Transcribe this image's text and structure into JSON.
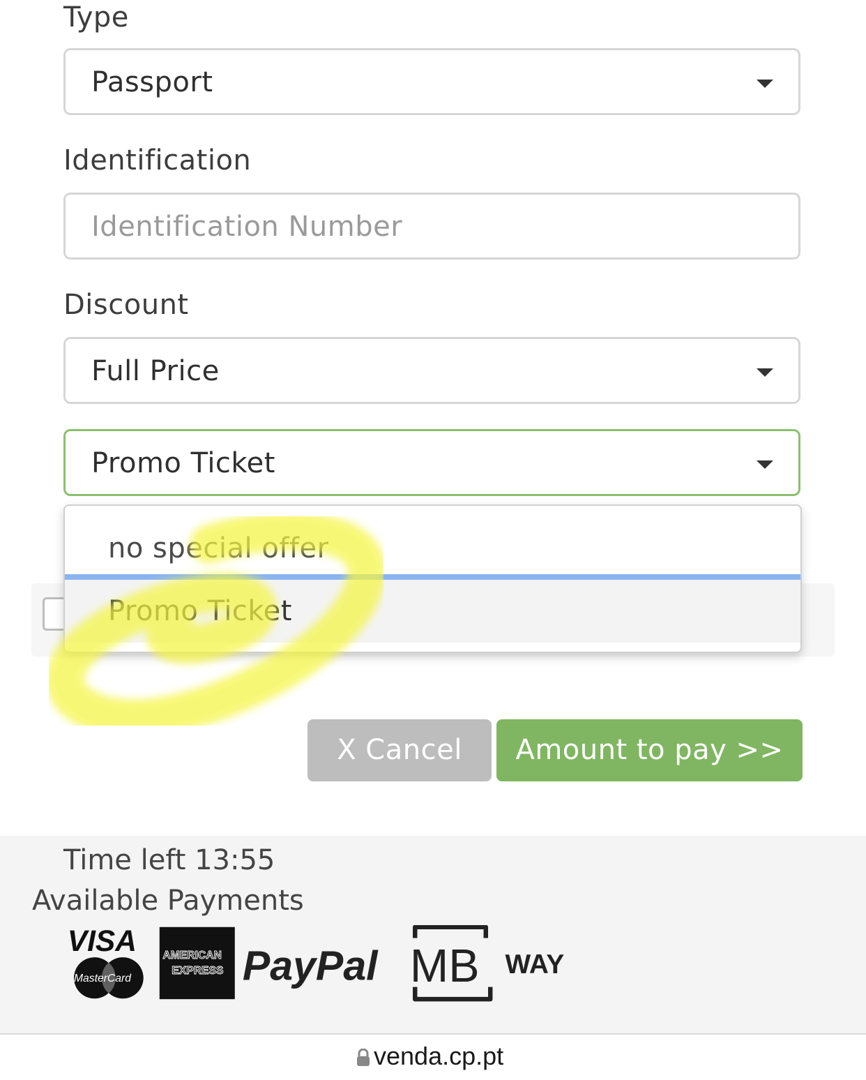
{
  "form": {
    "type_label": "Type",
    "type_value": "Passport",
    "identification_label": "Identification",
    "identification_placeholder": "Identification Number",
    "discount_label": "Discount",
    "discount_value": "Full Price",
    "promo_value": "Promo Ticket"
  },
  "dropdown": {
    "options": [
      {
        "label": "no special offer",
        "selected": false
      },
      {
        "label": "Promo Ticket",
        "selected": true
      }
    ]
  },
  "buttons": {
    "cancel_label": "X Cancel",
    "pay_label": "Amount to pay >>"
  },
  "footer": {
    "timer_text": "Time left 13:55",
    "payments_label": "Available Payments",
    "logos": {
      "visa": "VISA",
      "mastercard": "MasterCard",
      "amex_line1": "AMERICAN",
      "amex_line2": "EXPRESS",
      "paypal": "PayPal",
      "mb": "MB",
      "way": "WAY"
    }
  },
  "browser": {
    "url": "venda.cp.pt"
  },
  "colors": {
    "accent_green": "#80b662",
    "focus_border": "#8cbf6e",
    "cancel_gray": "#bdbdbd",
    "highlight": "#f5f542"
  }
}
